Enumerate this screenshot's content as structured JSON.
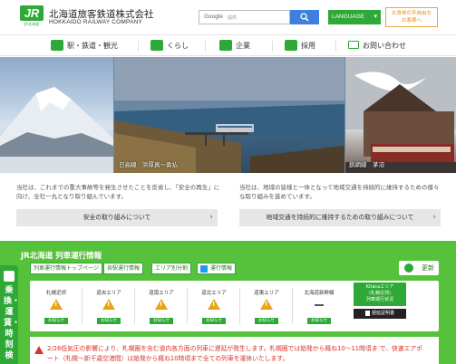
{
  "header": {
    "logo_text": "JR",
    "logo_sub": "JR北海道",
    "company_jp": "北海道旅客鉄道株式会社",
    "company_en": "HOKKAIDO RAILWAY COMPANY",
    "search_label": "Google",
    "search_sub": "提供",
    "language": "LANGUAGE",
    "help_line1": "お身体の不自由な",
    "help_line2": "お客様へ"
  },
  "nav": {
    "items": [
      "駅・鉄道・観光",
      "くらし",
      "企業",
      "採用",
      "お問い合わせ"
    ]
  },
  "hero": {
    "caption_center": "日高線　浜厚真～勇払",
    "caption_right": "釧網線　茅沼"
  },
  "notices": {
    "left_text": "当社は、これまでの重大事故等を発生させたことを反省し、「安全の再生」に向け、全社一丸となり取り組んでいます。",
    "left_button": "安全の取り組みについて",
    "right_text": "当社は、地域の皆様と一体となって地域交通を持続的に維持するための様々な取り組みを進めています。",
    "right_button": "地域交通を持続的に維持するための取り組みについて"
  },
  "train_info": {
    "title": "JR北海道 列車運行情報",
    "tabs": [
      "列車運行情報トップページ",
      "各駅運行情報",
      "エリア別分割",
      "運行情報"
    ],
    "update": "更新",
    "areas": [
      {
        "name": "札幌近郊",
        "status": "お知らせ",
        "warning": true
      },
      {
        "name": "道央エリア",
        "status": "お知らせ",
        "warning": true
      },
      {
        "name": "道南エリア",
        "status": "お知らせ",
        "warning": true
      },
      {
        "name": "道北エリア",
        "status": "お知らせ",
        "warning": true
      },
      {
        "name": "道東エリア",
        "status": "お知らせ",
        "warning": true
      },
      {
        "name": "北海道新幹線",
        "status": "お知らせ",
        "warning": false
      }
    ],
    "kitaca_line1": "Kitacaエリア",
    "kitaca_line2": "(札幌近郊)",
    "kitaca_line3": "列車運行状況",
    "delay_cert": "遅延証明書",
    "alert": "2/26低気圧の影響により、札幌圏を含む道内各方面の列車に遅延が発生します。札幌圏では始発から概ね10～11時頃ま で、快速エアポート（札幌～新千歳空港間）は始発から概ね10時頃まで全ての列車を運休いたします。"
  },
  "sidetab": {
    "text": "乗換・運賃・時刻検"
  }
}
